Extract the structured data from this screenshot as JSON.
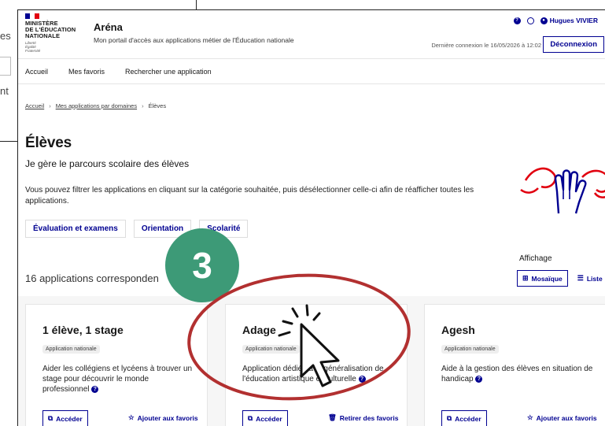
{
  "background_window": {
    "fragments": [
      "es",
      "nt"
    ]
  },
  "header": {
    "ministry": [
      "MINISTÈRE",
      "DE L'ÉDUCATION",
      "NATIONALE"
    ],
    "motto": [
      "Liberté",
      "Égalité",
      "Fraternité"
    ],
    "app_title": "Aréna",
    "app_subtitle": "Mon portail d'accès aux applications métier de l'Éducation nationale",
    "user_name": "Hugues VIVIER",
    "last_login": "Dernière connexion le 16/05/2026 à 12:02",
    "logout_label": "Déconnexion"
  },
  "nav": {
    "items": [
      "Accueil",
      "Mes favoris",
      "Rechercher une application"
    ]
  },
  "breadcrumb": {
    "items": [
      "Accueil",
      "Mes applications par domaines",
      "Élèves"
    ],
    "separator": "›"
  },
  "page": {
    "title": "Élèves",
    "lead": "Je gère le parcours scolaire des élèves",
    "description": "Vous pouvez filtrer les applications en cliquant sur la catégorie souhaitée, puis désélectionner celle-ci afin de réafficher toutes les applications.",
    "categories": [
      "Évaluation et examens",
      "Orientation",
      "Scolarité"
    ],
    "results_count": "16 applications corresponden",
    "display_label": "Affichage",
    "display_modes": [
      "Mosaïque",
      "Liste"
    ]
  },
  "cards": [
    {
      "title": "1 élève, 1 stage",
      "badge": "Application nationale",
      "description": "Aider les collégiens et lycéens à trouver un stage pour découvrir le monde professionnel",
      "access_label": "Accéder",
      "favorite_label": "Ajouter aux favoris"
    },
    {
      "title": "Adage",
      "badge": "Application nationale",
      "description": "Application dédiée à la généralisation de l'éducation artistique et culturelle",
      "access_label": "Accéder",
      "favorite_label": "Retirer des favoris"
    },
    {
      "title": "Agesh",
      "badge": "Application nationale",
      "description": "Aide à la gestion des élèves en situation de handicap",
      "access_label": "Accéder",
      "favorite_label": "Ajouter aux favoris"
    }
  ],
  "annotation": {
    "step_number": "3"
  },
  "colors": {
    "primary": "#000091",
    "step": "#3d9a77",
    "highlight_ellipse": "#b23030",
    "flag_blue": "#000091",
    "flag_red": "#e1000f"
  },
  "icons": [
    "help-icon",
    "settings-icon",
    "user-icon",
    "external-link-icon",
    "star-icon",
    "trash-icon",
    "grid-icon",
    "list-icon",
    "pointer-cursor-icon"
  ]
}
